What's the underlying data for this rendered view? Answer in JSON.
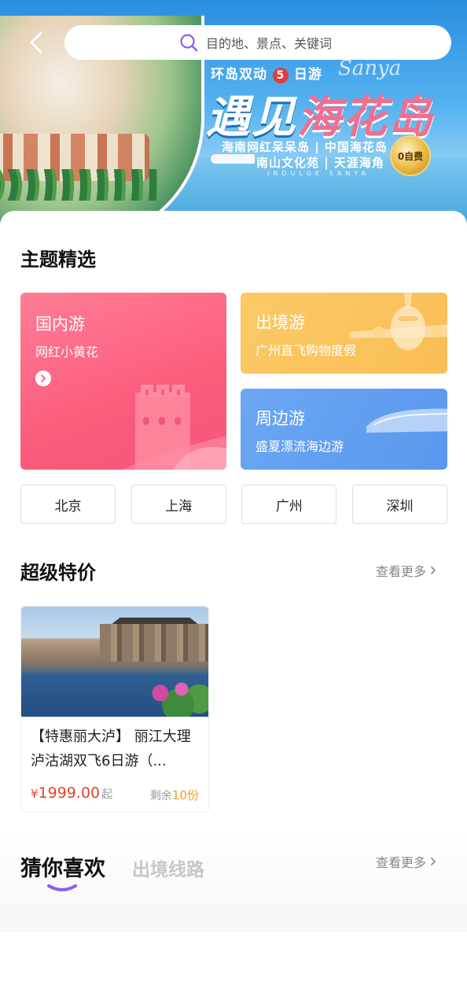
{
  "search": {
    "placeholder": "目的地、景点、关键词"
  },
  "banner": {
    "subtitle_prefix": "环岛双动",
    "subtitle_num": "5",
    "subtitle_suffix": "日游",
    "headline_a": "遇见",
    "headline_b": "海花岛",
    "script": "Sanya",
    "line1": "海南网红呆呆岛 | 中国海花岛",
    "line2": "南山文化苑 | 天涯海角",
    "tagline": "INDULGE SANYA",
    "badge": "0自费"
  },
  "themes": {
    "title": "主题精选",
    "cards": [
      {
        "title": "国内游",
        "subtitle": "网红小黄花"
      },
      {
        "title": "出境游",
        "subtitle": "广州直飞购物度假"
      },
      {
        "title": "周边游",
        "subtitle": "盛夏漂流海边游"
      }
    ],
    "cities": [
      "北京",
      "上海",
      "广州",
      "深圳"
    ]
  },
  "deals": {
    "title": "超级特价",
    "more": "查看更多",
    "items": [
      {
        "title": "【特惠丽大泸】 丽江大理泸沽湖双飞6日游（...",
        "currency": "¥",
        "price": "1999.00",
        "price_unit": "起",
        "stock_label": "剩余",
        "stock_count": "10份"
      }
    ]
  },
  "guess": {
    "tabs": [
      "猜你喜欢",
      "出境线路"
    ],
    "more": "查看更多"
  },
  "colors": {
    "accent_purple": "#8a5cf0",
    "price_red": "#e6412b",
    "stock_orange": "#f29a1e",
    "domestic_pink": "#fb5c7c",
    "abroad_yellow": "#f8be55",
    "nearby_blue": "#5b97ee"
  },
  "icons": {
    "back": "chevron-left-icon",
    "search": "search-icon",
    "more": "chevron-right-icon"
  }
}
